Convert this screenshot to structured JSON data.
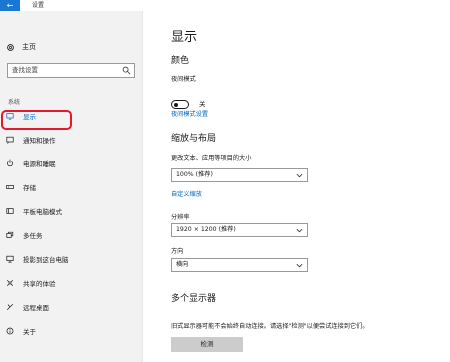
{
  "titlebar": {
    "back": "←",
    "title": "设置"
  },
  "sidebar": {
    "home_label": "主页",
    "search_placeholder": "查找设置",
    "section_label": "系统",
    "items": [
      {
        "label": "显示",
        "icon": "monitor-icon",
        "active": true
      },
      {
        "label": "通知和操作",
        "icon": "notification-icon"
      },
      {
        "label": "电源和睡眠",
        "icon": "power-icon"
      },
      {
        "label": "存储",
        "icon": "storage-icon"
      },
      {
        "label": "平板电脑模式",
        "icon": "tablet-icon"
      },
      {
        "label": "多任务",
        "icon": "multitask-icon"
      },
      {
        "label": "投影到这台电脑",
        "icon": "project-icon"
      },
      {
        "label": "共享的体验",
        "icon": "share-icon"
      },
      {
        "label": "远程桌面",
        "icon": "remote-icon"
      },
      {
        "label": "关于",
        "icon": "info-icon"
      }
    ]
  },
  "main": {
    "title": "显示",
    "color_heading": "颜色",
    "night_mode_label": "夜间模式",
    "night_mode_state": "关",
    "night_mode_settings_link": "夜间模式设置",
    "scale_heading": "缩放与布局",
    "scale_label": "更改文本、应用等项目的大小",
    "scale_value": "100% (推荐)",
    "custom_scale_link": "自定义缩放",
    "resolution_label": "分辨率",
    "resolution_value": "1920 × 1200 (推荐)",
    "orientation_label": "方向",
    "orientation_value": "横向",
    "multi_display_heading": "多个显示器",
    "multi_display_desc": "旧式显示器可能不会始终自动连接。请选择\"检测\"以便尝试连接到它们。",
    "detect_button": "检测"
  },
  "colors": {
    "accent": "#1978d2",
    "link": "#0066b8",
    "highlight": "#e21a2e"
  }
}
